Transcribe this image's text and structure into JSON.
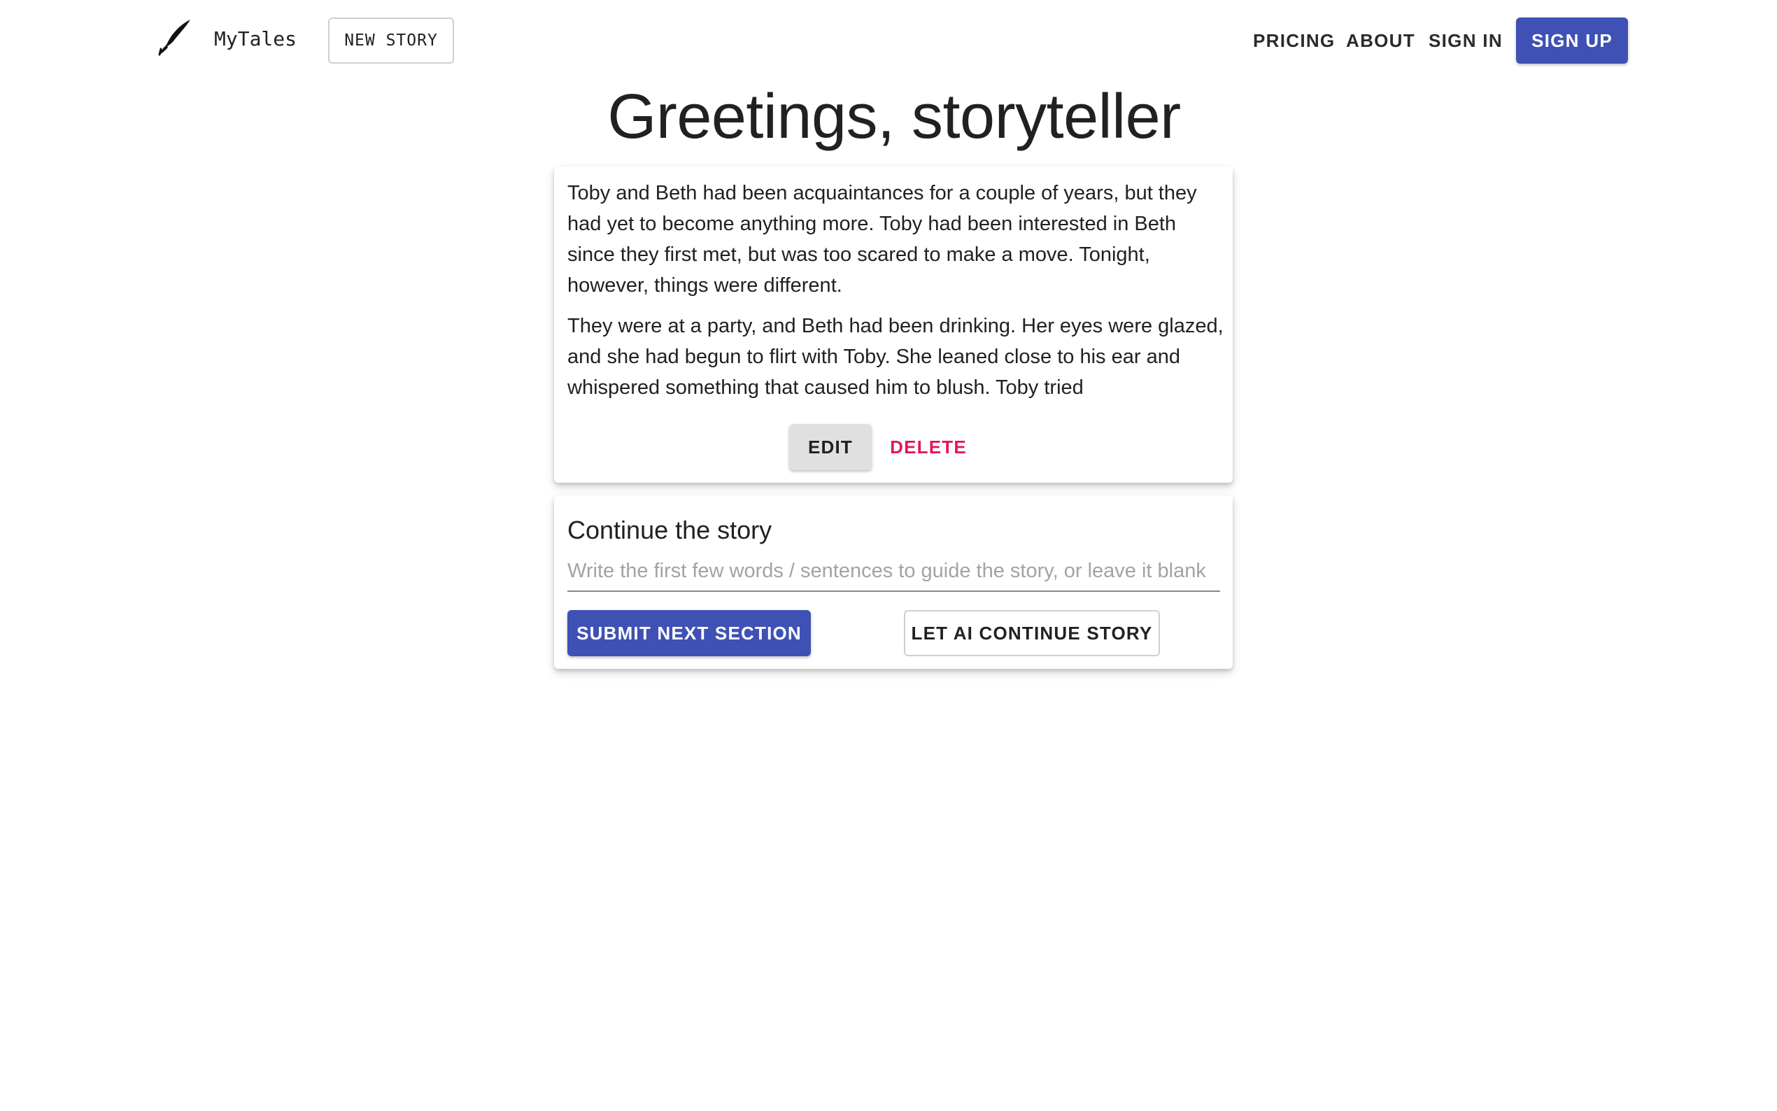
{
  "header": {
    "logo_icon": "quill-pen-icon",
    "brand": "MyTales",
    "new_story_label": "NEW STORY",
    "nav": {
      "pricing": "PRICING",
      "about": "ABOUT",
      "sign_in": "SIGN IN",
      "sign_up": "SIGN UP"
    }
  },
  "page": {
    "title": "Greetings, storyteller"
  },
  "story": {
    "paragraphs": [
      "Toby and Beth had been acquaintances for a couple of years, but they had yet to become anything more. Toby had been interested in Beth since they first met, but was too scared to make a move. Tonight, however, things were different.",
      "They were at a party, and Beth had been drinking. Her eyes were glazed, and she had begun to flirt with Toby. She leaned close to his ear and whispered something that caused him to blush. Toby tried"
    ],
    "edit_label": "EDIT",
    "delete_label": "DELETE"
  },
  "continue": {
    "title": "Continue the story",
    "input_value": "",
    "input_placeholder": "Write the first few words / sentences to guide the story, or leave it blank",
    "submit_label": "SUBMIT NEXT SECTION",
    "ai_label": "LET AI CONTINUE STORY"
  },
  "colors": {
    "primary": "#3f51b5",
    "delete": "#e0175f",
    "edit_bg": "#e0e0e0"
  }
}
